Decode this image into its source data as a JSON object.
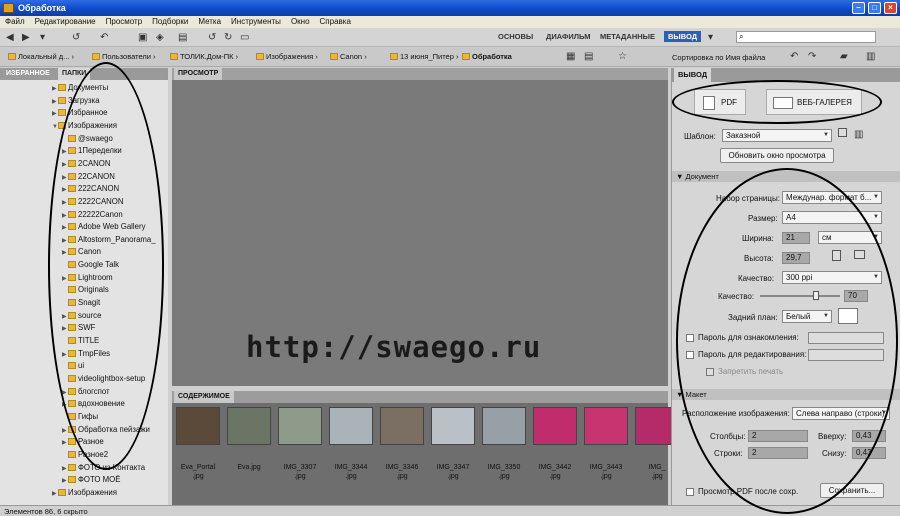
{
  "window": {
    "title": "Обработка"
  },
  "menu": [
    "Файл",
    "Редактирование",
    "Просмотр",
    "Подборки",
    "Метка",
    "Инструменты",
    "Окно",
    "Справка"
  ],
  "workspaces": [
    "ОСНОВЫ",
    "ДИАФИЛЬМ",
    "МЕТАДАННЫЕ",
    "ВЫВОД"
  ],
  "search": {
    "value": ""
  },
  "breadcrumbs": [
    "Локальный д...",
    "Пользователи",
    "ТОЛИК.Дом-ПК",
    "Изображения",
    "Canon",
    "13 июня_Питер",
    "Обработка"
  ],
  "sort_label": "Сортировка по Имя файла",
  "left_tabs": [
    "ИЗБРАННОЕ",
    "ПАПКИ"
  ],
  "tree": [
    {
      "label": "Документы",
      "indent": 1,
      "arrow": "▶"
    },
    {
      "label": "Загрузка",
      "indent": 1,
      "arrow": "▶"
    },
    {
      "label": "Избранное",
      "indent": 1,
      "arrow": "▶"
    },
    {
      "label": "Изображения",
      "indent": 1,
      "arrow": "▼"
    },
    {
      "label": "@swaego",
      "indent": 2,
      "arrow": ""
    },
    {
      "label": "1Переделки",
      "indent": 2,
      "arrow": "▶"
    },
    {
      "label": "2CANON",
      "indent": 2,
      "arrow": "▶"
    },
    {
      "label": "22CANON",
      "indent": 2,
      "arrow": "▶"
    },
    {
      "label": "222CANON",
      "indent": 2,
      "arrow": "▶"
    },
    {
      "label": "2222CANON",
      "indent": 2,
      "arrow": "▶"
    },
    {
      "label": "22222Canon",
      "indent": 2,
      "arrow": "▶"
    },
    {
      "label": "Adobe Web Gallery",
      "indent": 2,
      "arrow": "▶"
    },
    {
      "label": "Altostorm_Panorama_",
      "indent": 2,
      "arrow": "▶"
    },
    {
      "label": "Canon",
      "indent": 2,
      "arrow": "▶"
    },
    {
      "label": "Google Talk",
      "indent": 2,
      "arrow": ""
    },
    {
      "label": "Lightroom",
      "indent": 2,
      "arrow": "▶"
    },
    {
      "label": "Originals",
      "indent": 2,
      "arrow": ""
    },
    {
      "label": "Snagit",
      "indent": 2,
      "arrow": ""
    },
    {
      "label": "source",
      "indent": 2,
      "arrow": "▶"
    },
    {
      "label": "SWF",
      "indent": 2,
      "arrow": "▶"
    },
    {
      "label": "TITLE",
      "indent": 2,
      "arrow": ""
    },
    {
      "label": "TmpFiles",
      "indent": 2,
      "arrow": "▶"
    },
    {
      "label": "ui",
      "indent": 2,
      "arrow": ""
    },
    {
      "label": "videolightbox-setup",
      "indent": 2,
      "arrow": ""
    },
    {
      "label": "блогспот",
      "indent": 2,
      "arrow": "▶"
    },
    {
      "label": "вдохновение",
      "indent": 2,
      "arrow": "▶"
    },
    {
      "label": "Гифы",
      "indent": 2,
      "arrow": ""
    },
    {
      "label": "Обработка пейзажи",
      "indent": 2,
      "arrow": "▶"
    },
    {
      "label": "Разное",
      "indent": 2,
      "arrow": "▶"
    },
    {
      "label": "Разное2",
      "indent": 2,
      "arrow": ""
    },
    {
      "label": "ФОТО из Контакта",
      "indent": 2,
      "arrow": "▶"
    },
    {
      "label": "ФОТО МОЁ",
      "indent": 2,
      "arrow": "▶"
    },
    {
      "label": "Изображения",
      "indent": 1,
      "arrow": "▶"
    }
  ],
  "preview": {
    "tab": "ПРОСМОТР",
    "watermark": "http://swaego.ru"
  },
  "content": {
    "tab": "СОДЕРЖИМОЕ",
    "items": [
      {
        "name": "Eva_Portal",
        "ext": ".jpg",
        "color": "#5b4a3a"
      },
      {
        "name": "Eva.jpg",
        "ext": "",
        "color": "#6b7565"
      },
      {
        "name": "IMG_3307",
        "ext": ".jpg",
        "color": "#8e9a8a"
      },
      {
        "name": "IMG_3344",
        "ext": ".jpg",
        "color": "#a9b3b8"
      },
      {
        "name": "IMG_3346",
        "ext": ".jpg",
        "color": "#7b6f64"
      },
      {
        "name": "IMG_3347",
        "ext": ".jpg",
        "color": "#b9c0c7"
      },
      {
        "name": "IMG_3350",
        "ext": ".jpg",
        "color": "#97a0a6"
      },
      {
        "name": "IMG_3442",
        "ext": ".jpg",
        "color": "#c02c6c"
      },
      {
        "name": "IMG_3443",
        "ext": ".jpg",
        "color": "#c8346f"
      },
      {
        "name": "IMG_",
        "ext": ".jpg",
        "color": "#b52a68"
      }
    ]
  },
  "output": {
    "tab": "ВЫВОД",
    "pdf_label": "PDF",
    "web_label": "ВЕБ-ГАЛЕРЕЯ",
    "template_label": "Шаблон:",
    "template_value": "Заказной",
    "refresh_label": "Обновить окно просмотра",
    "document_section": "Документ",
    "page_setup_label": "Набор страницы:",
    "page_setup_value": "Междунар. формат б...",
    "size_label": "Размер:",
    "size_value": "A4",
    "width_label": "Ширина:",
    "width_value": "21",
    "unit_value": "см",
    "height_label": "Высота:",
    "height_value": "29,7",
    "quality_label": "Качество:",
    "quality_value": "300 ppi",
    "quality2_label": "Качество:",
    "quality2_value": "70",
    "quality2_fraction": 0.7,
    "background_label": "Задний план:",
    "background_value": "Белый",
    "open_pwd_label": "Пароль для ознакомления:",
    "edit_pwd_label": "Пароль для редактирования:",
    "no_print_label": "Запретить печать",
    "layout_section": "Макет",
    "image_layout_label": "Расположение изображения:",
    "image_layout_value": "Слева направо (строки)",
    "columns_label": "Столбцы:",
    "columns_value": "2",
    "rows_label": "Строки:",
    "rows_value": "2",
    "top_label": "Вверху:",
    "top_value": "0,43",
    "bottom_label": "Снизу:",
    "bottom_value": "0,43",
    "view_pdf_label": "Просмотр PDF после сохр.",
    "save_label": "Сохранить..."
  },
  "status": "Элементов 86, 6 скрыто"
}
